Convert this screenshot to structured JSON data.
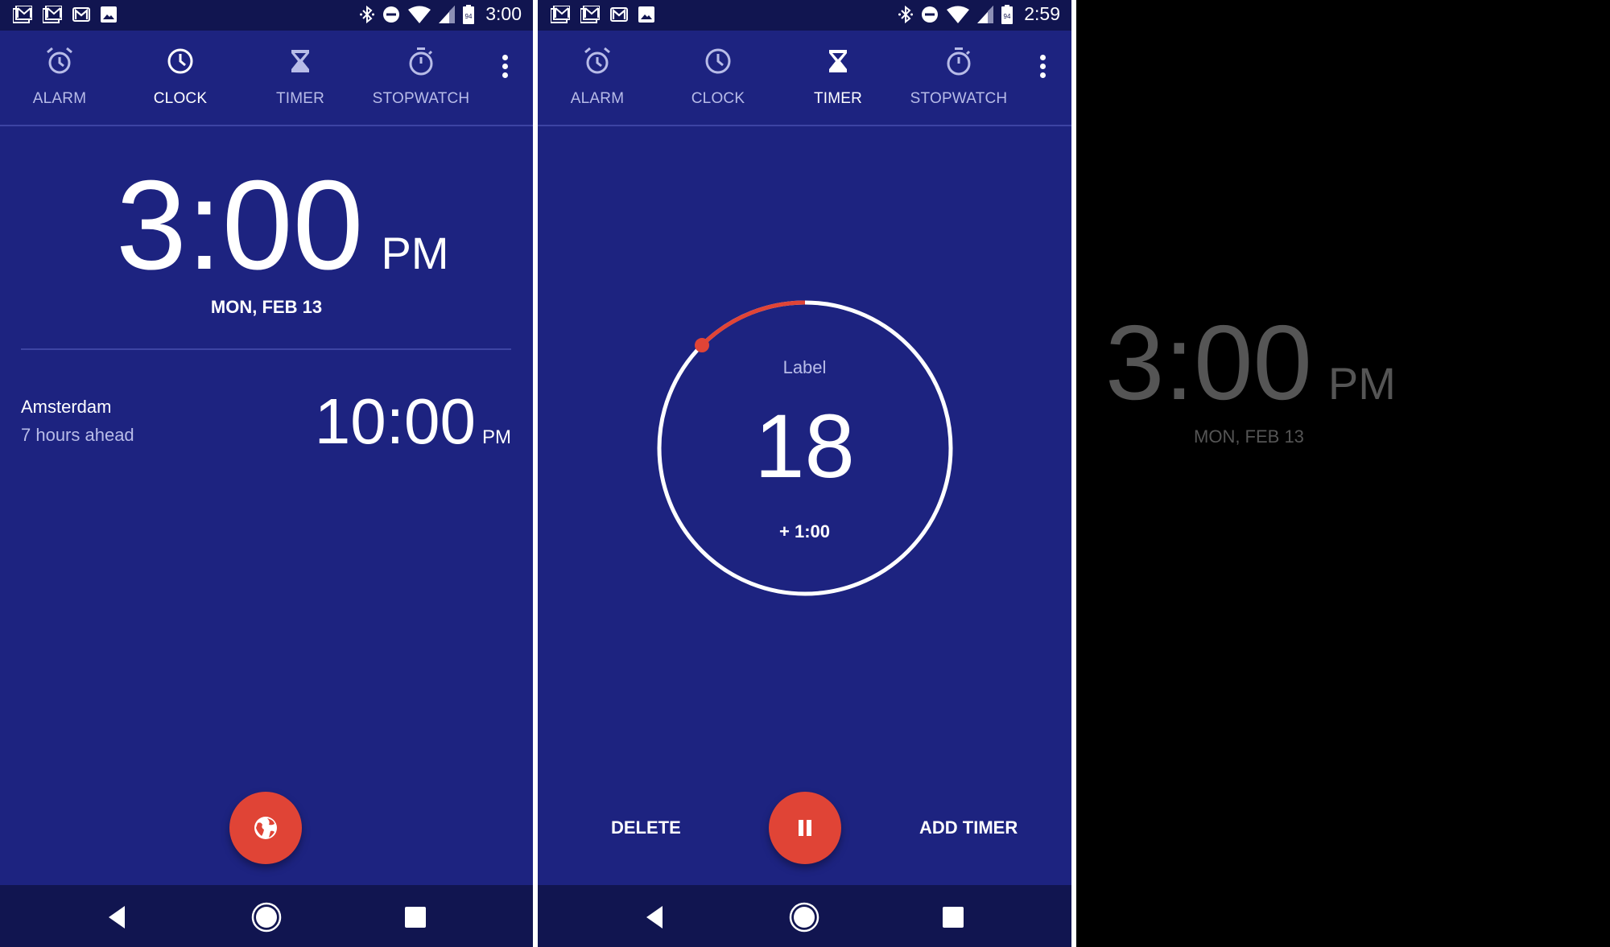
{
  "colors": {
    "app_bg": "#1d2380",
    "bar_bg": "#111550",
    "accent_red": "#e04436",
    "inactive_tab": "#b8bce8",
    "screensaver_text": "#555555"
  },
  "panels": [
    {
      "status_bar": {
        "notification_icons": [
          "gmail-stack-icon",
          "gmail-stack-icon",
          "gmail-icon",
          "image-icon"
        ],
        "system_icons": [
          "bluetooth-icon",
          "do-not-disturb-icon",
          "wifi-icon",
          "signal-icon",
          "battery-icon"
        ],
        "battery_level": "94",
        "time": "3:00"
      },
      "tabs": [
        {
          "label": "ALARM",
          "icon": "alarm-icon",
          "active": false
        },
        {
          "label": "CLOCK",
          "icon": "clock-icon",
          "active": true
        },
        {
          "label": "TIMER",
          "icon": "hourglass-icon",
          "active": false
        },
        {
          "label": "STOPWATCH",
          "icon": "stopwatch-icon",
          "active": false
        }
      ],
      "clock": {
        "time": "3:00",
        "ampm": "PM",
        "date": "MON, FEB 13"
      },
      "world_clock": [
        {
          "city": "Amsterdam",
          "offset": "7 hours ahead",
          "time": "10:00",
          "ampm": "PM"
        }
      ],
      "fab": {
        "icon": "globe-icon"
      },
      "nav": [
        "back-icon",
        "home-icon",
        "recents-icon"
      ]
    },
    {
      "status_bar": {
        "notification_icons": [
          "gmail-stack-icon",
          "gmail-stack-icon",
          "gmail-icon",
          "image-icon"
        ],
        "system_icons": [
          "bluetooth-icon",
          "do-not-disturb-icon",
          "wifi-icon",
          "signal-icon",
          "battery-icon"
        ],
        "battery_level": "94",
        "time": "2:59"
      },
      "tabs": [
        {
          "label": "ALARM",
          "icon": "alarm-icon",
          "active": false
        },
        {
          "label": "CLOCK",
          "icon": "clock-icon",
          "active": false
        },
        {
          "label": "TIMER",
          "icon": "hourglass-icon",
          "active": true
        },
        {
          "label": "STOPWATCH",
          "icon": "stopwatch-icon",
          "active": false
        }
      ],
      "timer": {
        "label": "Label",
        "remaining": "18",
        "add_time": "+ 1:00",
        "elapsed_fraction": 0.125
      },
      "actions": {
        "delete": "DELETE",
        "add_timer": "ADD TIMER",
        "fab_icon": "pause-icon"
      },
      "nav": [
        "back-icon",
        "home-icon",
        "recents-icon"
      ]
    },
    {
      "screensaver": {
        "time": "3:00",
        "ampm": "PM",
        "date": "MON, FEB 13"
      }
    }
  ]
}
